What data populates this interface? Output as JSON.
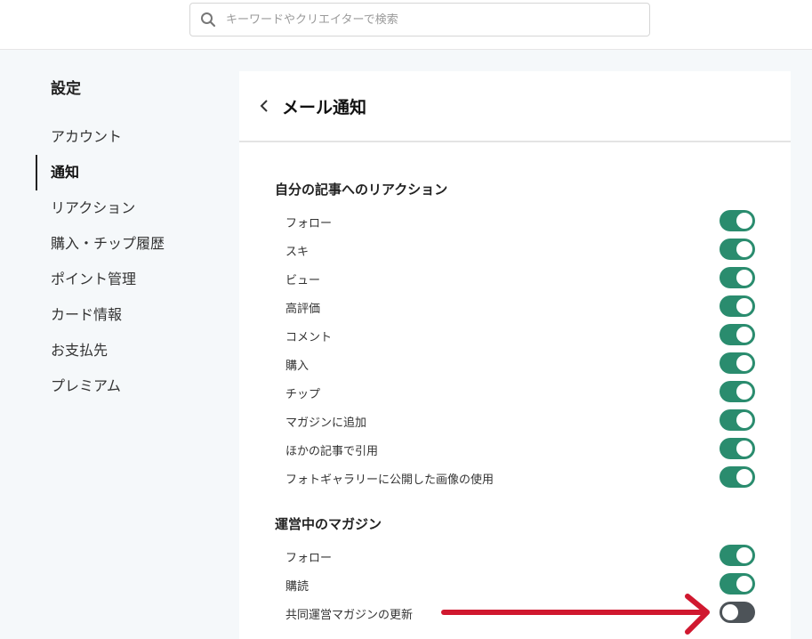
{
  "search": {
    "placeholder": "キーワードやクリエイターで検索",
    "icon": "search-icon"
  },
  "sidebar": {
    "title": "設定",
    "items": [
      {
        "label": "アカウント",
        "active": false
      },
      {
        "label": "通知",
        "active": true
      },
      {
        "label": "リアクション",
        "active": false
      },
      {
        "label": "購入・チップ履歴",
        "active": false
      },
      {
        "label": "ポイント管理",
        "active": false
      },
      {
        "label": "カード情報",
        "active": false
      },
      {
        "label": "お支払先",
        "active": false
      },
      {
        "label": "プレミアム",
        "active": false
      }
    ]
  },
  "main": {
    "title": "メール通知",
    "back_icon": "chevron-left-icon",
    "sections": [
      {
        "title": "自分の記事へのリアクション",
        "rows": [
          {
            "label": "フォロー",
            "on": true
          },
          {
            "label": "スキ",
            "on": true
          },
          {
            "label": "ビュー",
            "on": true
          },
          {
            "label": "高評価",
            "on": true
          },
          {
            "label": "コメント",
            "on": true
          },
          {
            "label": "購入",
            "on": true
          },
          {
            "label": "チップ",
            "on": true
          },
          {
            "label": "マガジンに追加",
            "on": true
          },
          {
            "label": "ほかの記事で引用",
            "on": true
          },
          {
            "label": "フォトギャラリーに公開した画像の使用",
            "on": true
          }
        ]
      },
      {
        "title": "運営中のマガジン",
        "rows": [
          {
            "label": "フォロー",
            "on": true
          },
          {
            "label": "購読",
            "on": true
          },
          {
            "label": "共同運営マガジンの更新",
            "on": false
          }
        ]
      }
    ]
  },
  "colors": {
    "toggle_on": "#2a8c6e",
    "toggle_off": "#4d5358",
    "annotation_arrow": "#d0182f"
  }
}
